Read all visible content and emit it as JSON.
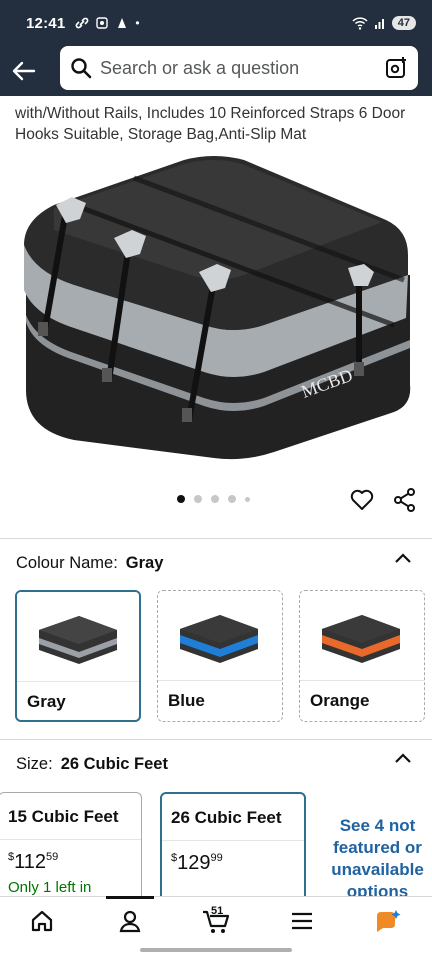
{
  "status": {
    "time": "12:41",
    "battery": "47"
  },
  "search": {
    "placeholder": "Search or ask a question"
  },
  "product": {
    "title_visible": "with/Without Rails, Includes 10 Reinforced Straps 6 Door Hooks Suitable, Storage Bag,Anti-Slip Mat",
    "brand_mark": "MCBD",
    "image_count": 5,
    "current_image": 1
  },
  "colour": {
    "label": "Colour Name:",
    "selected": "Gray",
    "options": [
      {
        "name": "Gray",
        "accent": "#9aa0a6"
      },
      {
        "name": "Blue",
        "accent": "#1f7fd8"
      },
      {
        "name": "Orange",
        "accent": "#e8692a"
      }
    ]
  },
  "size": {
    "label": "Size:",
    "selected": "26 Cubic Feet",
    "options": [
      {
        "name": "15 Cubic Feet",
        "price_symbol": "$",
        "price_whole": "112",
        "price_frac": "59",
        "stock": "Only 1 left in"
      },
      {
        "name": "26 Cubic Feet",
        "price_symbol": "$",
        "price_whole": "129",
        "price_frac": "99",
        "stock": ""
      }
    ],
    "see_more": "See 4 not featured or unavailable options"
  },
  "nav": {
    "items": [
      "home-icon",
      "account-icon",
      "cart-icon",
      "menu-icon",
      "rufus-icon"
    ],
    "cart_count": "51",
    "active": "account"
  },
  "colors": {
    "header_bg": "#232f3e",
    "link": "#2162a1",
    "selected_border": "#2f6f8f",
    "in_stock": "#007600"
  }
}
